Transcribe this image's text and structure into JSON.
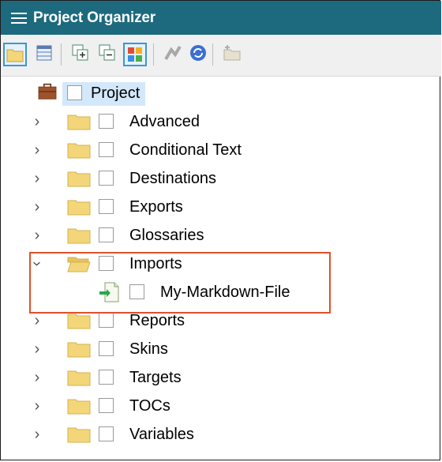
{
  "window": {
    "title": "Project Organizer"
  },
  "toolbar": {
    "buttons": [
      {
        "icon": "folder-view-icon",
        "active": true
      },
      {
        "icon": "grid-view-icon",
        "active": false
      },
      {
        "icon": "expand-all-icon",
        "active": false
      },
      {
        "icon": "collapse-all-icon",
        "active": false
      },
      {
        "icon": "color-grid-icon",
        "active": true
      },
      {
        "icon": "publish-icon",
        "active": false
      },
      {
        "icon": "refresh-icon",
        "active": false
      },
      {
        "icon": "new-item-icon",
        "active": false
      }
    ]
  },
  "tree": {
    "root": {
      "label": "Project",
      "icon": "briefcase-icon"
    },
    "items": [
      {
        "label": "Advanced",
        "expanded": false
      },
      {
        "label": "Conditional Text",
        "expanded": false
      },
      {
        "label": "Destinations",
        "expanded": false
      },
      {
        "label": "Exports",
        "expanded": false
      },
      {
        "label": "Glossaries",
        "expanded": false
      },
      {
        "label": "Imports",
        "expanded": true,
        "children": [
          {
            "label": "My-Markdown-File",
            "icon": "import-file-icon"
          }
        ]
      },
      {
        "label": "Reports",
        "expanded": false
      },
      {
        "label": "Skins",
        "expanded": false
      },
      {
        "label": "Targets",
        "expanded": false
      },
      {
        "label": "TOCs",
        "expanded": false
      },
      {
        "label": "Variables",
        "expanded": false
      }
    ]
  },
  "colors": {
    "titlebar": "#1d6a7e",
    "highlight_box": "#e0502a",
    "selected_row": "#d4e8fb",
    "folder": "#f4d67a"
  }
}
